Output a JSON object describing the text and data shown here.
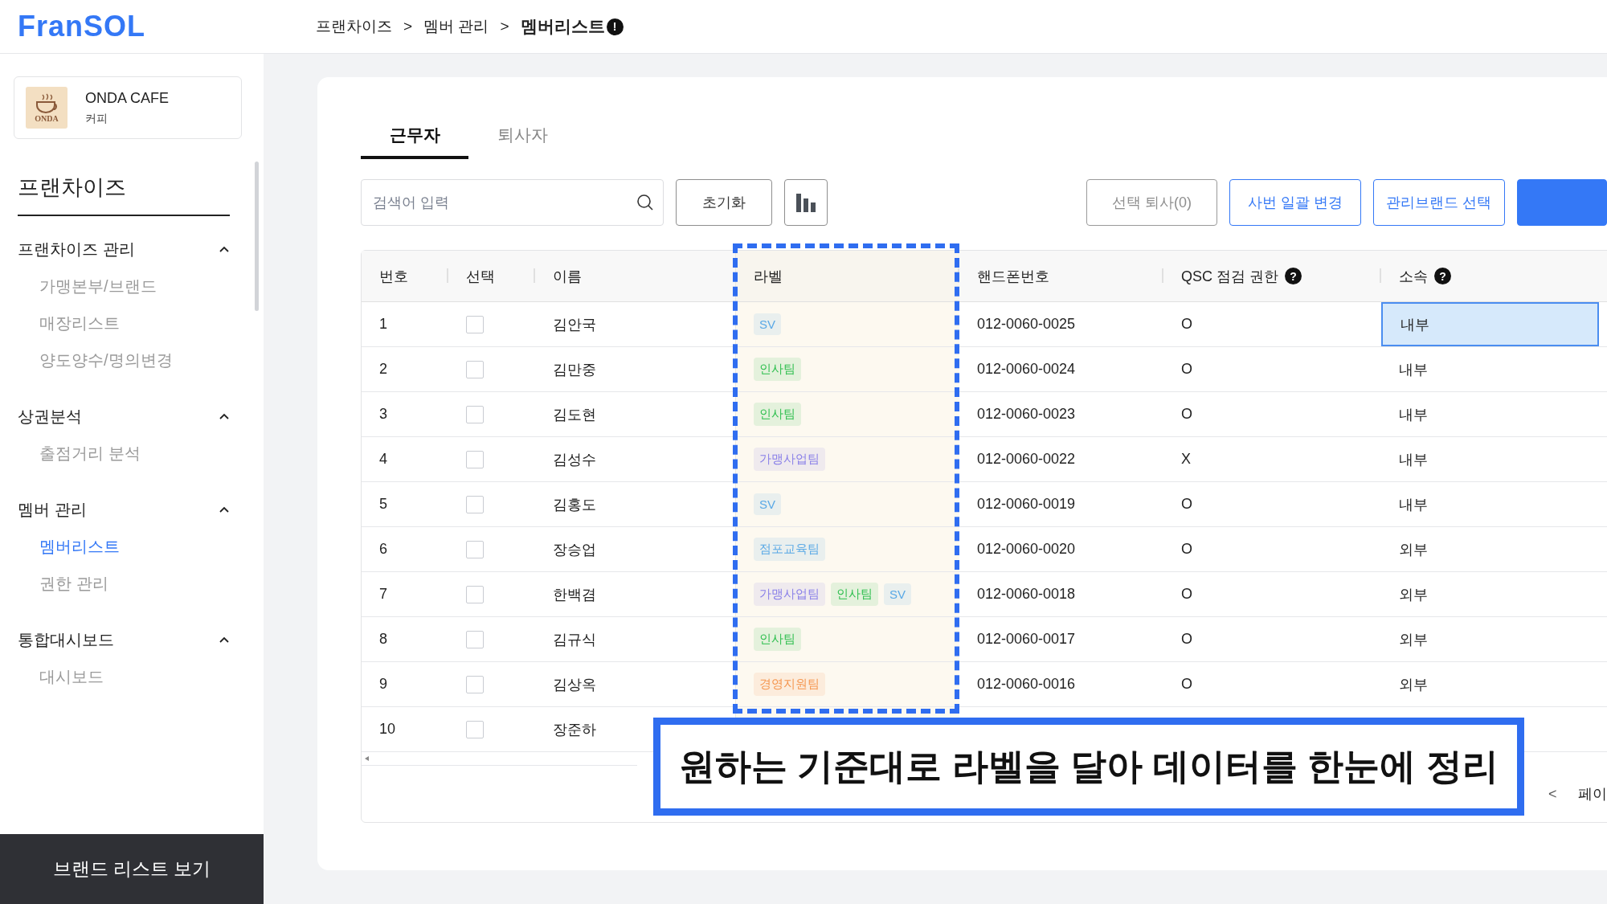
{
  "header": {
    "logo": "FranSOL",
    "breadcrumb": [
      {
        "label": "프랜차이즈",
        "current": false
      },
      {
        "label": "멤버 관리",
        "current": false
      },
      {
        "label": "멤버리스트",
        "current": true
      }
    ],
    "breadcrumb_separator": ">",
    "info_mark": "!"
  },
  "sidebar": {
    "brand": {
      "logo_text": "ONDA",
      "name": "ONDA CAFE",
      "category": "커피"
    },
    "title": "프랜차이즈",
    "sections": [
      {
        "label": "프랜차이즈 관리",
        "expanded": true,
        "items": [
          {
            "label": "가맹본부/브랜드",
            "selected": false
          },
          {
            "label": "매장리스트",
            "selected": false
          },
          {
            "label": "양도양수/명의변경",
            "selected": false
          }
        ]
      },
      {
        "label": "상권분석",
        "expanded": true,
        "items": [
          {
            "label": "출점거리 분석",
            "selected": false
          }
        ]
      },
      {
        "label": "멤버 관리",
        "expanded": true,
        "items": [
          {
            "label": "멤버리스트",
            "selected": true
          },
          {
            "label": "권한 관리",
            "selected": false
          }
        ]
      },
      {
        "label": "통합대시보드",
        "expanded": true,
        "items": [
          {
            "label": "대시보드",
            "selected": false
          }
        ]
      }
    ],
    "bottom_button": "브랜드 리스트 보기"
  },
  "tabs": [
    {
      "label": "근무자",
      "selected": true
    },
    {
      "label": "퇴사자",
      "selected": false
    }
  ],
  "toolbar": {
    "search": {
      "placeholder": "검색어 입력"
    },
    "reset_button": "초기화",
    "buttons": [
      {
        "label": "선택 퇴사(0)",
        "kind": "disabled"
      },
      {
        "label": "사번 일괄 변경",
        "kind": "outline"
      },
      {
        "label": "관리브랜드 선택",
        "kind": "outline"
      },
      {
        "kind": "primary"
      }
    ]
  },
  "table": {
    "columns": [
      "번호",
      "선택",
      "이름",
      "라벨",
      "핸드폰번호",
      "QSC 점검 권한",
      "소속"
    ],
    "help_mark": "?",
    "rows": [
      {
        "no": "1",
        "checked": false,
        "name": "김안국",
        "labels": [
          {
            "text": "SV",
            "color": "#5aa9e6"
          }
        ],
        "phone": "012-0060-0025",
        "qsc": "O",
        "affiliation": "내부",
        "affiliation_selected": true
      },
      {
        "no": "2",
        "checked": false,
        "name": "김만중",
        "labels": [
          {
            "text": "인사팀",
            "color": "#2fbf4f"
          }
        ],
        "phone": "012-0060-0024",
        "qsc": "O",
        "affiliation": "내부",
        "affiliation_selected": false
      },
      {
        "no": "3",
        "checked": false,
        "name": "김도현",
        "labels": [
          {
            "text": "인사팀",
            "color": "#2fbf4f"
          }
        ],
        "phone": "012-0060-0023",
        "qsc": "O",
        "affiliation": "내부",
        "affiliation_selected": false
      },
      {
        "no": "4",
        "checked": false,
        "name": "김성수",
        "labels": [
          {
            "text": "가맹사업팀",
            "color": "#8a80e8"
          }
        ],
        "phone": "012-0060-0022",
        "qsc": "X",
        "affiliation": "내부",
        "affiliation_selected": false
      },
      {
        "no": "5",
        "checked": false,
        "name": "김홍도",
        "labels": [
          {
            "text": "SV",
            "color": "#5aa9e6"
          }
        ],
        "phone": "012-0060-0019",
        "qsc": "O",
        "affiliation": "내부",
        "affiliation_selected": false
      },
      {
        "no": "6",
        "checked": false,
        "name": "장승업",
        "labels": [
          {
            "text": "점포교육팀",
            "color": "#5aa9e6"
          }
        ],
        "phone": "012-0060-0020",
        "qsc": "O",
        "affiliation": "외부",
        "affiliation_selected": false
      },
      {
        "no": "7",
        "checked": false,
        "name": "한백겸",
        "labels": [
          {
            "text": "가맹사업팀",
            "color": "#8a80e8"
          },
          {
            "text": "인사팀",
            "color": "#2fbf4f"
          },
          {
            "text": "SV",
            "color": "#5aa9e6"
          }
        ],
        "phone": "012-0060-0018",
        "qsc": "O",
        "affiliation": "외부",
        "affiliation_selected": false
      },
      {
        "no": "8",
        "checked": false,
        "name": "김규식",
        "labels": [
          {
            "text": "인사팀",
            "color": "#2fbf4f"
          }
        ],
        "phone": "012-0060-0017",
        "qsc": "O",
        "affiliation": "외부",
        "affiliation_selected": false
      },
      {
        "no": "9",
        "checked": false,
        "name": "김상옥",
        "labels": [
          {
            "text": "경영지원팀",
            "color": "#f5964f"
          }
        ],
        "phone": "012-0060-0016",
        "qsc": "O",
        "affiliation": "외부",
        "affiliation_selected": false
      },
      {
        "no": "10",
        "checked": false,
        "name": "장준하",
        "labels": []
      }
    ],
    "pagination": {
      "prev": "<",
      "label": "페이"
    }
  },
  "caption": "원하는 기준대로 라벨을 달아 데이터를 한눈에 정리"
}
